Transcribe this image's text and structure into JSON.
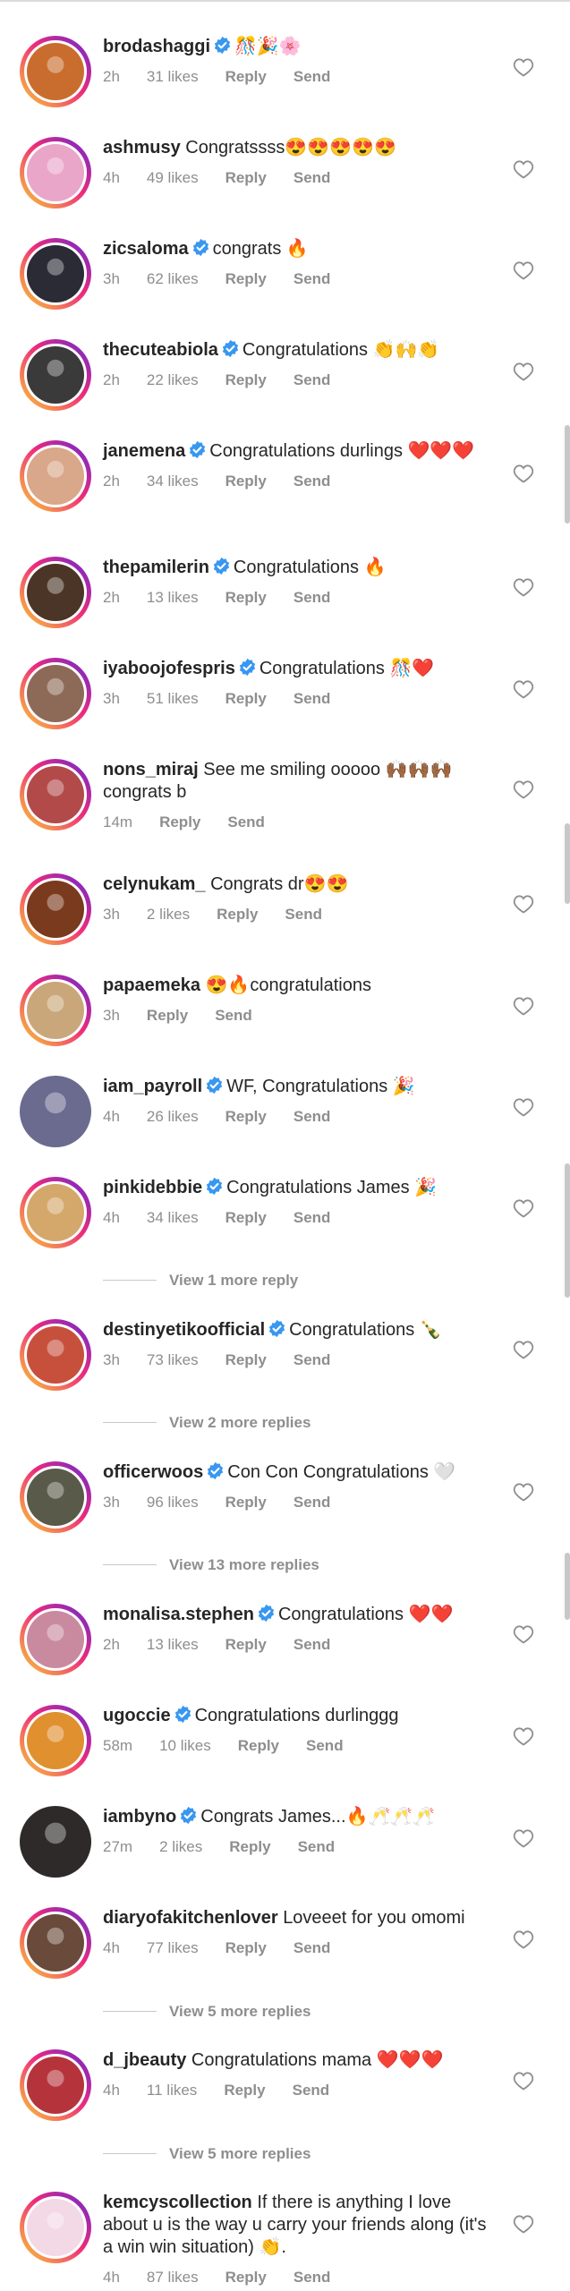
{
  "actions": {
    "reply": "Reply",
    "send": "Send"
  },
  "comments": [
    {
      "user": "brodashaggi",
      "verified": true,
      "text": "🎊🎉🌸",
      "time": "2h",
      "likes": "31 likes",
      "avatar_color": "#c96d2e"
    },
    {
      "user": "ashmusy",
      "verified": false,
      "text": "Congratssss😍😍😍😍😍",
      "time": "4h",
      "likes": "49 likes",
      "avatar_color": "#e9a6c8"
    },
    {
      "user": "zicsaloma",
      "verified": true,
      "text": "congrats 🔥",
      "time": "3h",
      "likes": "62 likes",
      "avatar_color": "#2b2b36"
    },
    {
      "user": "thecuteabiola",
      "verified": true,
      "text": "Congratulations 👏🙌👏",
      "time": "2h",
      "likes": "22 likes",
      "avatar_color": "#3a3a3a"
    },
    {
      "user": "janemena",
      "verified": true,
      "text": "Congratulations durlings ❤️❤️❤️",
      "time": "2h",
      "likes": "34 likes",
      "avatar_color": "#d9a78a"
    },
    {
      "user": "thepamilerin",
      "verified": true,
      "text": "Congratulations 🔥",
      "time": "2h",
      "likes": "13 likes",
      "avatar_color": "#4a3526"
    },
    {
      "user": "iyaboojofespris",
      "verified": true,
      "text": "Congratulations 🎊❤️",
      "time": "3h",
      "likes": "51 likes",
      "avatar_color": "#8d6a58"
    },
    {
      "user": "nons_miraj",
      "verified": false,
      "text": "See me smiling ooooo 🙌🏾🙌🏾🙌🏾 congrats b",
      "time": "14m",
      "likes": "",
      "avatar_color": "#b24a4a"
    },
    {
      "user": "celynukam_",
      "verified": false,
      "text": "Congrats dr😍😍",
      "time": "3h",
      "likes": "2 likes",
      "avatar_color": "#7a3a1e"
    },
    {
      "user": "papaemeka",
      "verified": false,
      "text": "😍🔥congratulations",
      "time": "3h",
      "likes": "",
      "avatar_color": "#caa77a"
    },
    {
      "user": "iam_payroll",
      "verified": true,
      "text": "WF, Congratulations 🎉",
      "time": "4h",
      "likes": "26 likes",
      "avatar_color": "#6b6a8f"
    },
    {
      "user": "pinkidebbie",
      "verified": true,
      "text": "Congratulations James 🎉",
      "time": "4h",
      "likes": "34 likes",
      "avatar_color": "#d4a86b"
    },
    {
      "user": "destinyetikoofficial",
      "verified": true,
      "text": "Congratulations 🍾",
      "time": "3h",
      "likes": "73 likes",
      "avatar_color": "#c7503c"
    },
    {
      "user": "officerwoos",
      "verified": true,
      "text": "Con Con Congratulations 🤍",
      "time": "3h",
      "likes": "96 likes",
      "avatar_color": "#5a5a4a"
    },
    {
      "user": "monalisa.stephen",
      "verified": true,
      "text": "Congratulations ❤️❤️",
      "time": "2h",
      "likes": "13 likes",
      "avatar_color": "#c98aa0"
    },
    {
      "user": "ugoccie",
      "verified": true,
      "text": "Congratulations durlinggg",
      "time": "58m",
      "likes": "10 likes",
      "avatar_color": "#e0902f"
    },
    {
      "user": "iambyno",
      "verified": true,
      "text": "Congrats James...🔥🥂🥂🥂",
      "time": "27m",
      "likes": "2 likes",
      "avatar_color": "#2e2a2a"
    },
    {
      "user": "diaryofakitchenlover",
      "verified": false,
      "text": "Loveeet for you omomi",
      "time": "4h",
      "likes": "77 likes",
      "avatar_color": "#6a4a3a"
    },
    {
      "user": "d_jbeauty",
      "verified": false,
      "text": "Congratulations mama ❤️❤️❤️",
      "time": "4h",
      "likes": "11 likes",
      "avatar_color": "#b5343c"
    },
    {
      "user": "kemcyscollection",
      "verified": false,
      "text": "If there is anything I love about u is the way u carry your friends along (it's a win win situation) 👏.",
      "time": "4h",
      "likes": "87 likes",
      "avatar_color": "#f3d9e6"
    }
  ],
  "view_more": [
    {
      "label": "View 1 more reply"
    },
    {
      "label": "View 2 more replies"
    },
    {
      "label": "View 13 more replies"
    },
    {
      "label": "View 5 more replies"
    },
    {
      "label": "View 5 more replies"
    }
  ]
}
